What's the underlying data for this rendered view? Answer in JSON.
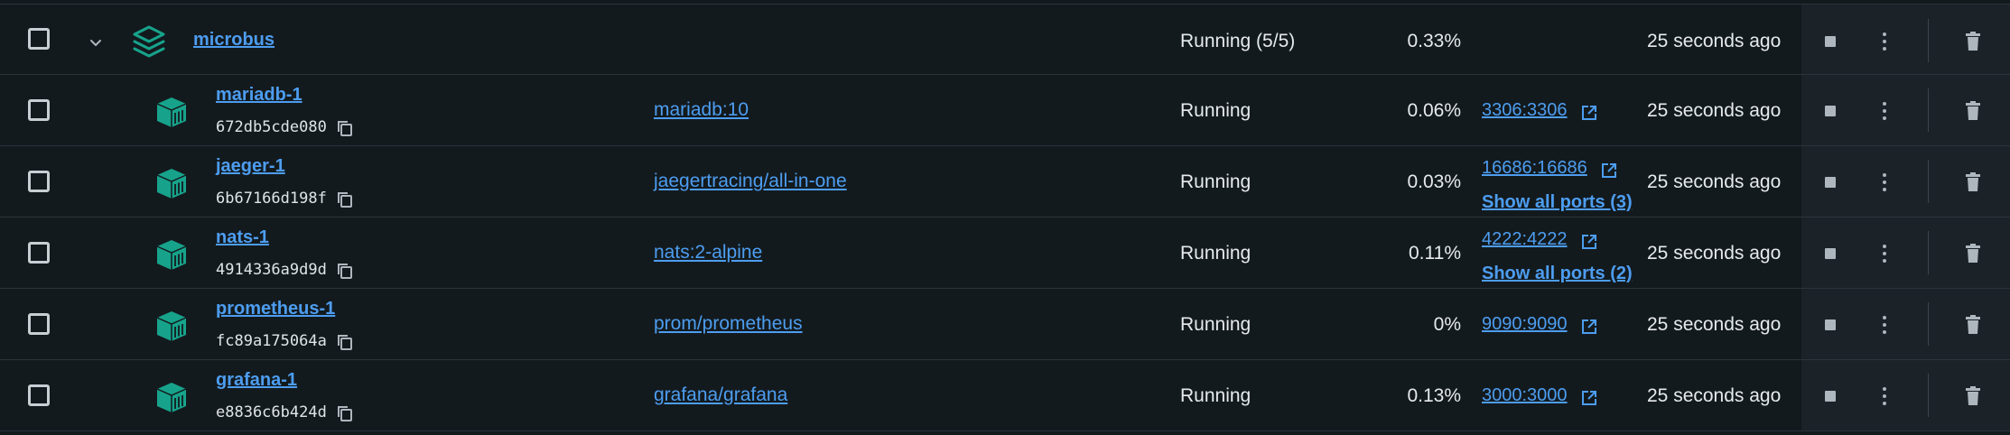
{
  "colors": {
    "background": "#131a1e",
    "link": "#4d9df0",
    "icon_teal": "#17a38b",
    "actions_background": "#1b2328"
  },
  "group": {
    "name": "microbus",
    "status": "Running (5/5)",
    "cpu": "0.33%",
    "last_started": "25 seconds ago"
  },
  "containers": [
    {
      "name": "mariadb-1",
      "id": "672db5cde080",
      "image": "mariadb:10",
      "status": "Running",
      "cpu": "0.06%",
      "port": "3306:3306",
      "show_ports": "",
      "last_started": "25 seconds ago"
    },
    {
      "name": "jaeger-1",
      "id": "6b67166d198f",
      "image": "jaegertracing/all-in-one",
      "status": "Running",
      "cpu": "0.03%",
      "port": "16686:16686",
      "show_ports": "Show all ports (3)",
      "last_started": "25 seconds ago"
    },
    {
      "name": "nats-1",
      "id": "4914336a9d9d",
      "image": "nats:2-alpine",
      "status": "Running",
      "cpu": "0.11%",
      "port": "4222:4222",
      "show_ports": "Show all ports (2)",
      "last_started": "25 seconds ago"
    },
    {
      "name": "prometheus-1",
      "id": "fc89a175064a",
      "image": "prom/prometheus",
      "status": "Running",
      "cpu": "0%",
      "port": "9090:9090",
      "show_ports": "",
      "last_started": "25 seconds ago"
    },
    {
      "name": "grafana-1",
      "id": "e8836c6b424d",
      "image": "grafana/grafana",
      "status": "Running",
      "cpu": "0.13%",
      "port": "3000:3000",
      "show_ports": "",
      "last_started": "25 seconds ago"
    }
  ],
  "icons": {
    "checkbox": "checkbox-unchecked-icon",
    "expand": "chevron-down-icon",
    "group": "stack-layers-icon",
    "container": "container-cube-icon",
    "copy": "copy-icon",
    "external": "external-link-icon",
    "stop": "stop-icon",
    "more": "more-vertical-icon",
    "delete": "trash-icon"
  }
}
